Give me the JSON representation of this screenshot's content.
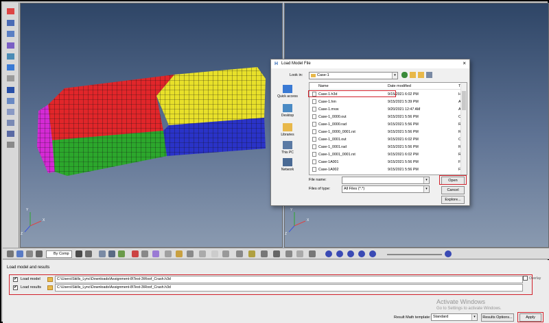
{
  "colors": {
    "highlight": "#d1202a",
    "mesh_red": "#e1262a",
    "mesh_yellow": "#e8e02a",
    "mesh_green": "#2ca72c",
    "mesh_blue": "#2a33c8",
    "mesh_magenta": "#d42ad4",
    "viewport_top": "#2e4566",
    "viewport_bottom": "#8a9ab0"
  },
  "toolbar": {
    "component_mode": "By Comp"
  },
  "panel": {
    "title": "Load model and results",
    "model_row": {
      "checked": true,
      "label": "Load model",
      "path": "C:\\Users\\Skills_Lync\\Downloads\\Assignment-8\\Test-3\\Roof_Crash.h3d"
    },
    "results_row": {
      "checked": true,
      "label": "Load results",
      "path": "C:\\Users\\Skills_Lync\\Downloads\\Assignment-8\\Test-3\\Roof_Crash.h3d"
    },
    "overlay_label": "Overlay",
    "template_label": "Result Math template:",
    "template_value": "Standard",
    "results_options_label": "Results Options...",
    "apply_label": "Apply"
  },
  "watermark": {
    "line1": "Activate Windows",
    "line2": "Go to Settings to activate Windows."
  },
  "dialog": {
    "title": "Load Model File",
    "look_in_label": "Look in:",
    "look_in_value": "Case-1",
    "places": [
      "Quick access",
      "Desktop",
      "Libraries",
      "This PC",
      "Network"
    ],
    "columns": {
      "name": "Name",
      "date": "Date modified",
      "type": "Ty"
    },
    "files": [
      {
        "name": "Case-1.h3d",
        "date": "9/15/2021 6:02 PM",
        "type": "H"
      },
      {
        "name": "Case-1.hm",
        "date": "9/15/2021 5:39 PM",
        "type": "Al"
      },
      {
        "name": "Case-1.mvw",
        "date": "9/20/2021 12:47 AM",
        "type": "Al"
      },
      {
        "name": "Case-1_0000.out",
        "date": "9/15/2021 5:56 PM",
        "type": "O"
      },
      {
        "name": "Case-1_0000.rad",
        "date": "9/15/2021 5:56 PM",
        "type": "R"
      },
      {
        "name": "Case-1_0000_0001.rst",
        "date": "9/15/2021 5:56 PM",
        "type": "R"
      },
      {
        "name": "Case-1_0001.out",
        "date": "9/15/2021 6:02 PM",
        "type": "O"
      },
      {
        "name": "Case-1_0001.rad",
        "date": "9/15/2021 5:56 PM",
        "type": "R"
      },
      {
        "name": "Case-1_0001_0001.rst",
        "date": "9/15/2021 6:02 PM",
        "type": "R"
      },
      {
        "name": "Case-1A001",
        "date": "9/15/2021 5:56 PM",
        "type": "Fi"
      },
      {
        "name": "Case-1A002",
        "date": "9/15/2021 5:56 PM",
        "type": "Fi"
      }
    ],
    "file_name_label": "File name:",
    "file_name_value": "",
    "file_type_label": "Files of type:",
    "file_type_value": "All Files (*.*)",
    "open_label": "Open",
    "cancel_label": "Cancel",
    "explore_label": "Explore..."
  }
}
